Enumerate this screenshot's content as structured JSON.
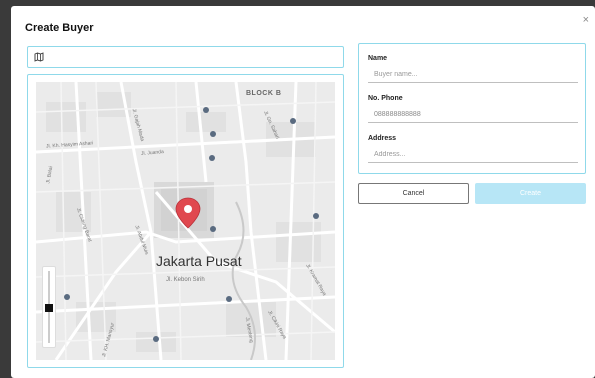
{
  "dialog": {
    "title": "Create Buyer",
    "close_label": "×"
  },
  "map": {
    "search_icon": "map-icon",
    "search_value": "",
    "city_label": "Jakarta Pusat",
    "block_label": "BLOCK B",
    "street_labels": [
      "Jl. Kebon Sirih",
      "Jl. Kh. Hasyim Ashari",
      "Jl. Gajah Mada",
      "Jl. Abdul Muis",
      "Jl. Cideng Barat",
      "Jl. Kramat Raya",
      "Jl. Juanda",
      "Jl. Balai",
      "Jl. KH. Mansyur",
      "Jl. Menteng",
      "Jl. Cikini Raya",
      "Jl. Gn. Sahari"
    ],
    "pin_color": "#e0484f",
    "zoom_level": 0.5
  },
  "form": {
    "name_label": "Name",
    "name_placeholder": "Buyer name...",
    "phone_label": "No. Phone",
    "phone_value": "088888888888",
    "address_label": "Address",
    "address_placeholder": "Address..."
  },
  "actions": {
    "cancel_label": "Cancel",
    "create_label": "Create"
  },
  "colors": {
    "accent_border": "#8fd9ea",
    "create_button": "#b7e6f6",
    "pin": "#e0484f"
  }
}
